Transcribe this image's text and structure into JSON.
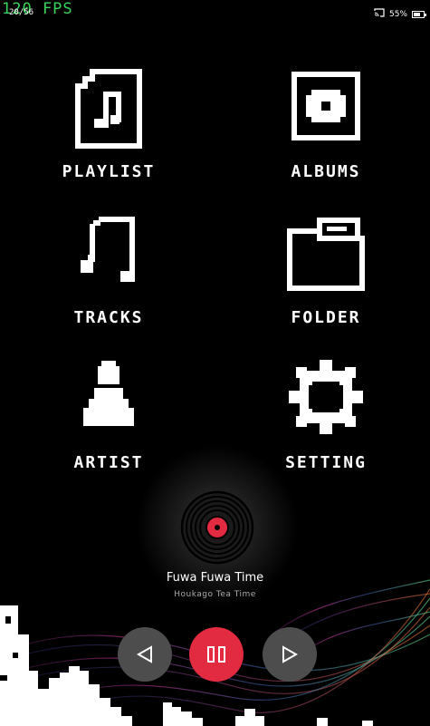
{
  "status": {
    "fps": "120 FPS",
    "track_counter": "20/56",
    "battery": "55%"
  },
  "menu": {
    "items": [
      {
        "label": "PLAYLIST"
      },
      {
        "label": "ALBUMS"
      },
      {
        "label": "TRACKS"
      },
      {
        "label": "FOLDER"
      },
      {
        "label": "ARTIST"
      },
      {
        "label": "SETTING"
      }
    ]
  },
  "now_playing": {
    "title": "Fuwa Fuwa Time",
    "artist": "Houkago Tea Time"
  },
  "colors": {
    "background": "#000000",
    "accent": "#e22a40",
    "control_gray": "#4d4d4d",
    "fps_green": "#39d45a"
  },
  "icons": {
    "playlist": "playlist-icon",
    "albums": "album-icon",
    "tracks": "music-note-icon",
    "folder": "folder-icon",
    "artist": "artist-icon",
    "setting": "gear-icon",
    "prev": "previous-icon",
    "pause": "pause-icon",
    "next": "next-icon"
  }
}
